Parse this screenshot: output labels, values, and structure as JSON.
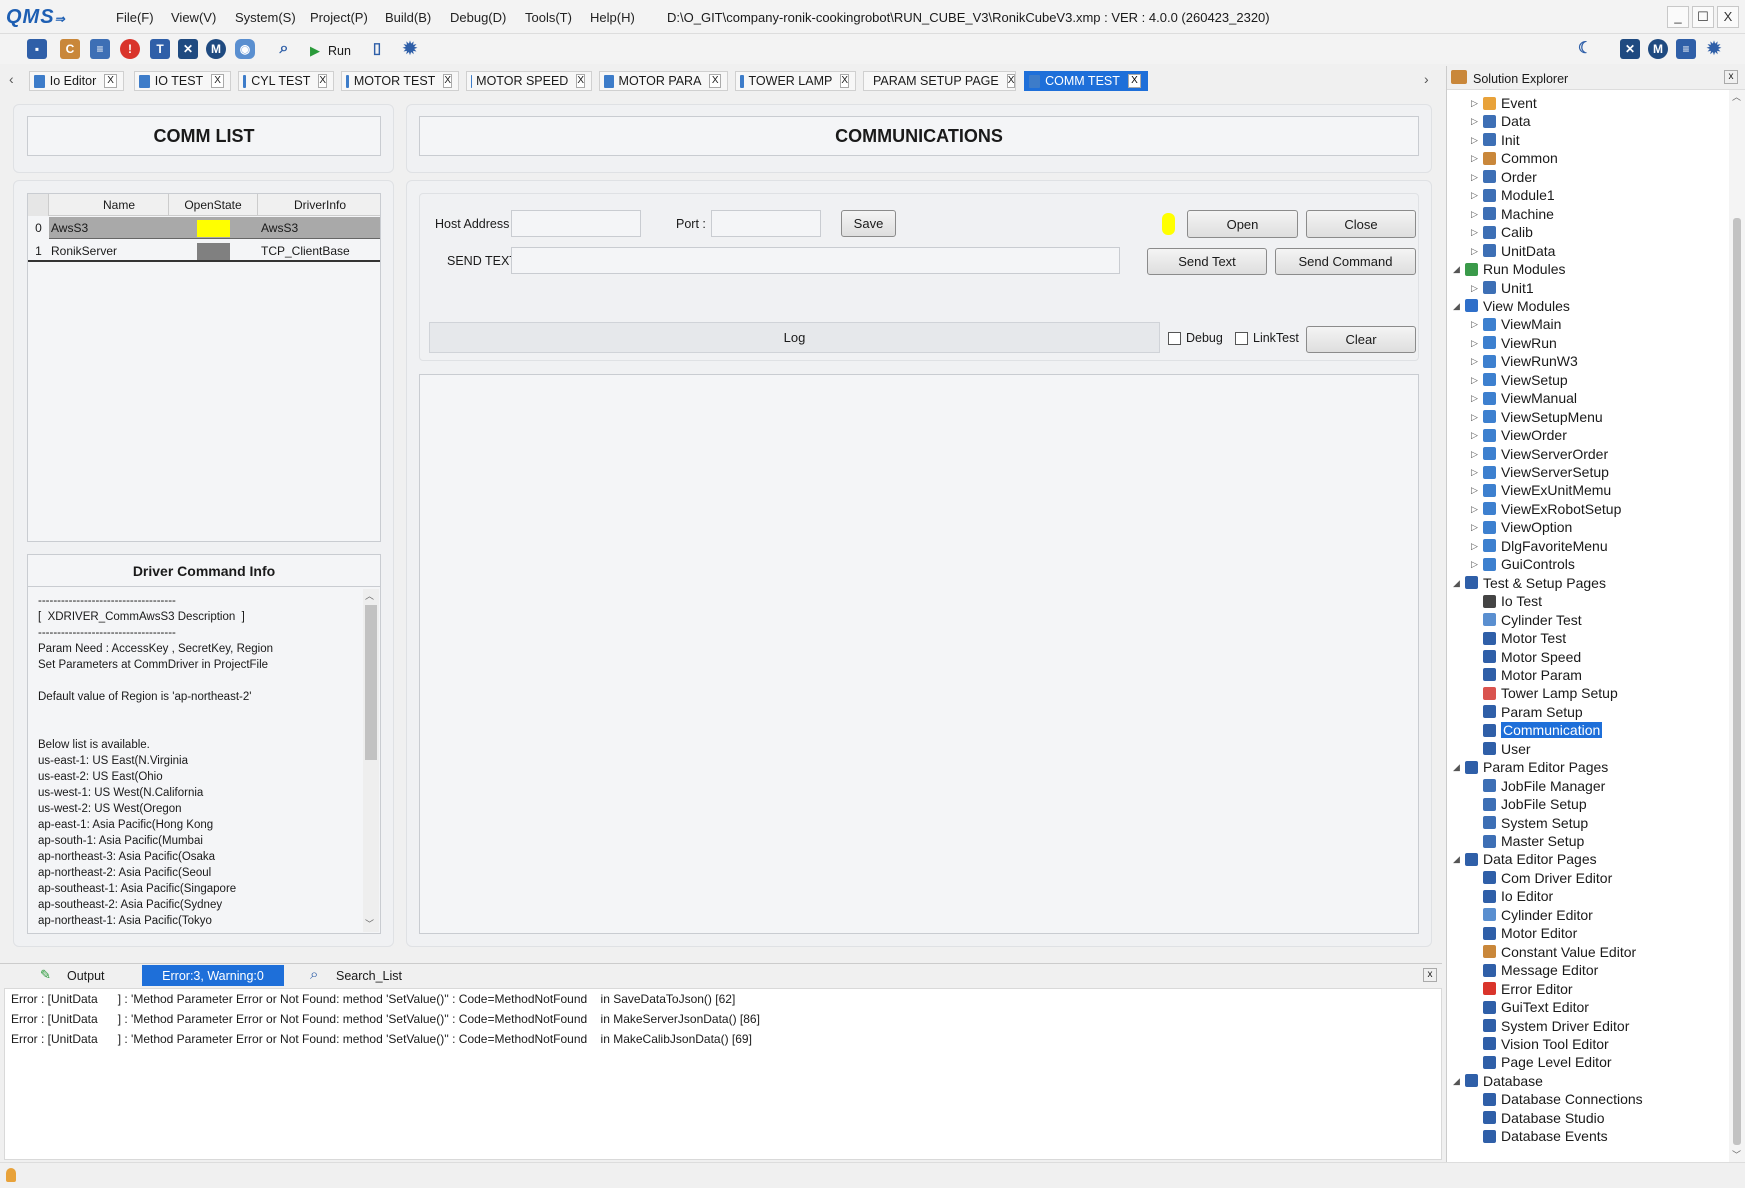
{
  "app": {
    "logo": "QMS",
    "title_path": "D:\\O_GIT\\company-ronik-cookingrobot\\RUN_CUBE_V3\\RonikCubeV3.xmp : VER : 4.0.0 (260423_2320)",
    "menus": [
      "File(F)",
      "View(V)",
      "System(S)",
      "Project(P)",
      "Build(B)",
      "Debug(D)",
      "Tools(T)",
      "Help(H)"
    ],
    "window_buttons": [
      "_",
      "☐",
      "X"
    ]
  },
  "toolbar": {
    "run_label": "Run"
  },
  "tabs": [
    {
      "label": "Io Editor",
      "active": false
    },
    {
      "label": "IO TEST",
      "active": false
    },
    {
      "label": "CYL TEST",
      "active": false
    },
    {
      "label": "MOTOR TEST",
      "active": false
    },
    {
      "label": "MOTOR SPEED",
      "active": false
    },
    {
      "label": "MOTOR PARA",
      "active": false
    },
    {
      "label": "TOWER LAMP",
      "active": false
    },
    {
      "label": "PARAM SETUP PAGE",
      "active": false
    },
    {
      "label": "COMM TEST",
      "active": true
    }
  ],
  "tab_close": "X",
  "comm_list": {
    "title": "COMM LIST",
    "columns": [
      "Name",
      "OpenState",
      "DriverInfo"
    ],
    "rows": [
      {
        "index": "0",
        "name": "AwsS3",
        "state_color": "#ffff00",
        "driver": "AwsS3"
      },
      {
        "index": "1",
        "name": "RonikServer",
        "state_color": "#808080",
        "driver": "TCP_ClientBase"
      }
    ]
  },
  "driver_info": {
    "title": "Driver Command Info",
    "lines": [
      "------------------------------------",
      "[  XDRIVER_CommAwsS3 Description  ]",
      "------------------------------------",
      "Param Need : AccessKey , SecretKey, Region",
      "Set Parameters at CommDriver in ProjectFile",
      "",
      "Default value of Region is 'ap-northeast-2'",
      "",
      "",
      "Below list is available.",
      "us-east-1: US East(N.Virginia",
      "us-east-2: US East(Ohio",
      "us-west-1: US West(N.California",
      "us-west-2: US West(Oregon",
      "ap-east-1: Asia Pacific(Hong Kong",
      "ap-south-1: Asia Pacific(Mumbai",
      "ap-northeast-3: Asia Pacific(Osaka",
      "ap-northeast-2: Asia Pacific(Seoul",
      "ap-southeast-1: Asia Pacific(Singapore",
      "ap-southeast-2: Asia Pacific(Sydney",
      "ap-northeast-1: Asia Pacific(Tokyo"
    ]
  },
  "comm": {
    "title": "COMMUNICATIONS",
    "host_label": "Host Address :",
    "host_value": "",
    "port_label": "Port :",
    "port_value": "",
    "save_label": "Save",
    "open_label": "Open",
    "close_label": "Close",
    "status_color": "#ffff00",
    "send_label": "SEND TEXT :",
    "send_value": "",
    "send_text_label": "Send Text",
    "send_command_label": "Send Command",
    "log_label": "Log",
    "debug_label": "Debug",
    "linktest_label": "LinkTest",
    "clear_label": "Clear"
  },
  "output": {
    "tabs": [
      "Output",
      "Error:3, Warning:0",
      "Search_List"
    ],
    "close": "x",
    "lines": [
      "Error : [UnitData      ] : 'Method Parameter Error or Not Found: method 'SetValue()'' : Code=MethodNotFound    in SaveDataToJson() [62]",
      "Error : [UnitData      ] : 'Method Parameter Error or Not Found: method 'SetValue()'' : Code=MethodNotFound    in MakeServerJsonData() [86]",
      "Error : [UnitData      ] : 'Method Parameter Error or Not Found: method 'SetValue()'' : Code=MethodNotFound    in MakeCalibJsonData() [69]"
    ]
  },
  "solution_explorer": {
    "title": "Solution Explorer",
    "close": "x",
    "nodes": [
      {
        "label": "Event",
        "level": 2,
        "icon": "lightning-icon",
        "color": "#e8a23a"
      },
      {
        "label": "Data",
        "level": 2,
        "icon": "list-icon",
        "color": "#3d6fb5"
      },
      {
        "label": "Init",
        "level": 2,
        "icon": "list-icon",
        "color": "#3d6fb5"
      },
      {
        "label": "Common",
        "level": 2,
        "icon": "book-icon",
        "color": "#c9873a"
      },
      {
        "label": "Order",
        "level": 2,
        "icon": "list-icon",
        "color": "#3d6fb5"
      },
      {
        "label": "Module1",
        "level": 2,
        "icon": "list-icon",
        "color": "#3d6fb5"
      },
      {
        "label": "Machine",
        "level": 2,
        "icon": "list-icon",
        "color": "#3d6fb5"
      },
      {
        "label": "Calib",
        "level": 2,
        "icon": "list-icon",
        "color": "#3d6fb5"
      },
      {
        "label": "UnitData",
        "level": 2,
        "icon": "list-icon",
        "color": "#3d6fb5"
      },
      {
        "label": "Run Modules",
        "level": 1,
        "icon": "check-folder-icon",
        "color": "#3a9a4a"
      },
      {
        "label": "Unit1",
        "level": 2,
        "icon": "list-icon",
        "color": "#3d6fb5"
      },
      {
        "label": "View Modules",
        "level": 1,
        "icon": "windows-icon",
        "color": "#2f6fc9"
      },
      {
        "label": "ViewMain",
        "level": 2,
        "icon": "window-icon",
        "color": "#3d80cf"
      },
      {
        "label": "ViewRun",
        "level": 2,
        "icon": "window-icon",
        "color": "#3d80cf"
      },
      {
        "label": "ViewRunW3",
        "level": 2,
        "icon": "window-icon",
        "color": "#3d80cf"
      },
      {
        "label": "ViewSetup",
        "level": 2,
        "icon": "window-icon",
        "color": "#3d80cf"
      },
      {
        "label": "ViewManual",
        "level": 2,
        "icon": "window-icon",
        "color": "#3d80cf"
      },
      {
        "label": "ViewSetupMenu",
        "level": 2,
        "icon": "window-icon",
        "color": "#3d80cf"
      },
      {
        "label": "ViewOrder",
        "level": 2,
        "icon": "window-icon",
        "color": "#3d80cf"
      },
      {
        "label": "ViewServerOrder",
        "level": 2,
        "icon": "window-icon",
        "color": "#3d80cf"
      },
      {
        "label": "ViewServerSetup",
        "level": 2,
        "icon": "window-icon",
        "color": "#3d80cf"
      },
      {
        "label": "ViewExUnitMemu",
        "level": 2,
        "icon": "window-icon",
        "color": "#3d80cf"
      },
      {
        "label": "ViewExRobotSetup",
        "level": 2,
        "icon": "window-icon",
        "color": "#3d80cf"
      },
      {
        "label": "ViewOption",
        "level": 2,
        "icon": "window-icon",
        "color": "#3d80cf"
      },
      {
        "label": "DlgFavoriteMenu",
        "level": 2,
        "icon": "window-icon",
        "color": "#3d80cf"
      },
      {
        "label": "GuiControls",
        "level": 2,
        "icon": "window-icon",
        "color": "#3d80cf"
      },
      {
        "label": "Test & Setup Pages",
        "level": 1,
        "icon": "pages-icon",
        "color": "#2f5fa8"
      },
      {
        "label": "Io Test",
        "level": 2,
        "icon": "io-icon",
        "color": "#444444",
        "leaf": true
      },
      {
        "label": "Cylinder Test",
        "level": 2,
        "icon": "cylinder-icon",
        "color": "#5a8fd0",
        "leaf": true
      },
      {
        "label": "Motor Test",
        "level": 2,
        "icon": "motor-icon",
        "color": "#2f5fa8",
        "leaf": true
      },
      {
        "label": "Motor Speed",
        "level": 2,
        "icon": "gauge-icon",
        "color": "#2f5fa8",
        "leaf": true
      },
      {
        "label": "Motor Param",
        "level": 2,
        "icon": "clock-icon",
        "color": "#2f5fa8",
        "leaf": true
      },
      {
        "label": "Tower Lamp Setup",
        "level": 2,
        "icon": "tower-lamp-icon",
        "color": "#d9534f",
        "leaf": true
      },
      {
        "label": "Param Setup",
        "level": 2,
        "icon": "list-icon",
        "color": "#2f5fa8",
        "leaf": true
      },
      {
        "label": "Communication",
        "level": 2,
        "icon": "communication-icon",
        "color": "#2f5fa8",
        "leaf": true,
        "selected": true
      },
      {
        "label": "User",
        "level": 2,
        "icon": "user-icon",
        "color": "#2f5fa8",
        "leaf": true
      },
      {
        "label": "Param Editor Pages",
        "level": 1,
        "icon": "pages-icon",
        "color": "#2f5fa8"
      },
      {
        "label": "JobFile Manager",
        "level": 2,
        "icon": "list-icon",
        "color": "#3d6fb5",
        "leaf": true
      },
      {
        "label": "JobFile Setup",
        "level": 2,
        "icon": "list-icon",
        "color": "#3d6fb5",
        "leaf": true
      },
      {
        "label": "System Setup",
        "level": 2,
        "icon": "list-icon",
        "color": "#3d6fb5",
        "leaf": true
      },
      {
        "label": "Master Setup",
        "level": 2,
        "icon": "list-icon",
        "color": "#3d6fb5",
        "leaf": true
      },
      {
        "label": "Data Editor Pages",
        "level": 1,
        "icon": "check-pages-icon",
        "color": "#2f5fa8"
      },
      {
        "label": "Com Driver Editor",
        "level": 2,
        "icon": "plug-icon",
        "color": "#2f5fa8",
        "leaf": true
      },
      {
        "label": "Io Editor",
        "level": 2,
        "icon": "io-icon",
        "color": "#2f5fa8",
        "leaf": true
      },
      {
        "label": "Cylinder Editor",
        "level": 2,
        "icon": "cylinder-icon",
        "color": "#5a8fd0",
        "leaf": true
      },
      {
        "label": "Motor Editor",
        "level": 2,
        "icon": "motor-icon",
        "color": "#2f5fa8",
        "leaf": true
      },
      {
        "label": "Constant Value Editor",
        "level": 2,
        "icon": "c-icon",
        "color": "#c9873a",
        "leaf": true
      },
      {
        "label": "Message Editor",
        "level": 2,
        "icon": "message-icon",
        "color": "#2f5fa8",
        "leaf": true
      },
      {
        "label": "Error Editor",
        "level": 2,
        "icon": "error-icon",
        "color": "#d9342b",
        "leaf": true
      },
      {
        "label": "GuiText Editor",
        "level": 2,
        "icon": "text-icon",
        "color": "#2f5fa8",
        "leaf": true
      },
      {
        "label": "System Driver Editor",
        "level": 2,
        "icon": "gear-icon",
        "color": "#2f5fa8",
        "leaf": true
      },
      {
        "label": "Vision Tool Editor",
        "level": 2,
        "icon": "vision-icon",
        "color": "#2f5fa8",
        "leaf": true
      },
      {
        "label": "Page Level Editor",
        "level": 2,
        "icon": "user-icon",
        "color": "#2f5fa8",
        "leaf": true
      },
      {
        "label": "Database",
        "level": 1,
        "icon": "check-pages-icon",
        "color": "#2f5fa8"
      },
      {
        "label": "Database Connections",
        "level": 2,
        "icon": "database-icon",
        "color": "#2f5fa8",
        "leaf": true
      },
      {
        "label": "Database Studio",
        "level": 2,
        "icon": "database-icon",
        "color": "#2f5fa8",
        "leaf": true
      },
      {
        "label": "Database Events",
        "level": 2,
        "icon": "database-icon",
        "color": "#2f5fa8",
        "leaf": true
      }
    ]
  }
}
